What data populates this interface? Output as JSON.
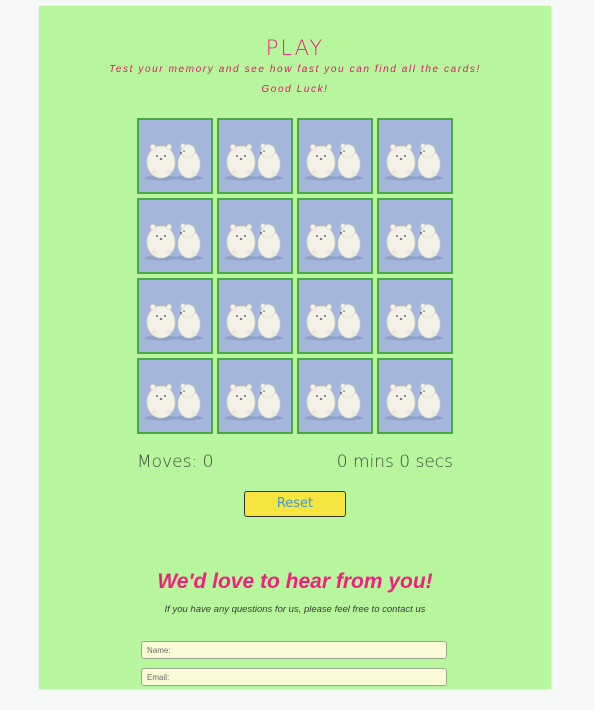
{
  "game": {
    "title": "PLAY",
    "subtitle": "Test your memory and see how fast you can find all the cards!",
    "good_luck": "Good Luck!",
    "card_count": 16,
    "moves_text": "Moves: 0",
    "timer_text": "0 mins 0 secs",
    "reset_label": "Reset"
  },
  "contact": {
    "heading": "We'd love to hear from you!",
    "subheading": "If you have any questions for us, please feel free to contact us",
    "name_placeholder": "Name:",
    "email_placeholder": "Email:"
  },
  "colors": {
    "page_bg": "#b8f69e",
    "accent_pink": "#f0217e",
    "card_bg": "#a5b6dc",
    "card_border": "#4aa84a",
    "reset_bg": "#f5e53e",
    "reset_text": "#3b9bd6"
  },
  "icons": {
    "card_face": "polar-bears-icon"
  }
}
